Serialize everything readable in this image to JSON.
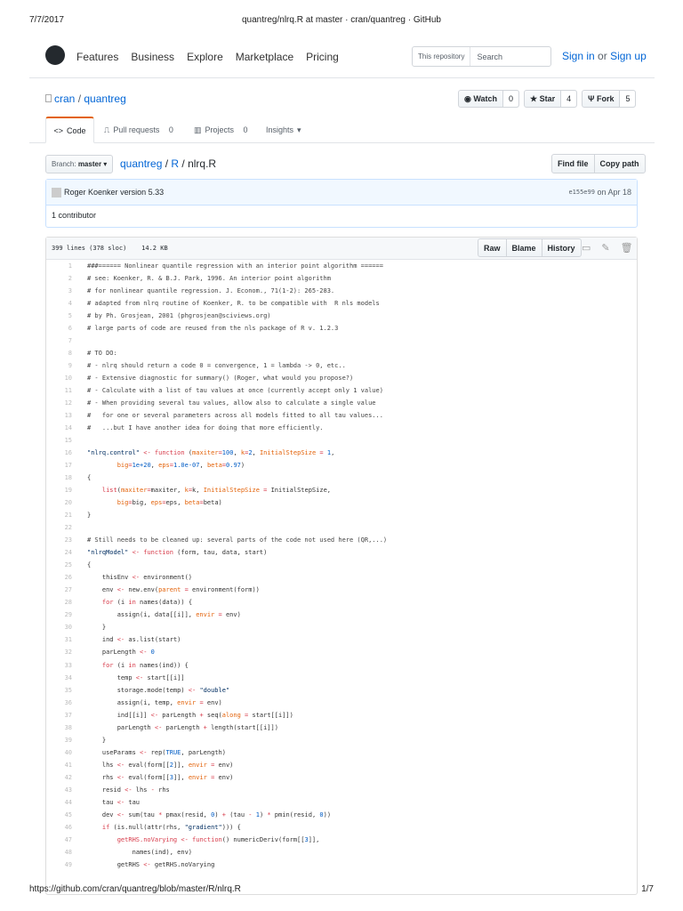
{
  "print": {
    "date": "7/7/2017",
    "title": "quantreg/nlrq.R at master · cran/quantreg · GitHub",
    "url": "https://github.com/cran/quantreg/blob/master/R/nlrq.R",
    "page": "1/7"
  },
  "nav": {
    "items": [
      "Features",
      "Business",
      "Explore",
      "Marketplace",
      "Pricing"
    ],
    "scope": "This repository",
    "search_placeholder": "Search",
    "sign_in": "Sign in",
    "or": "or",
    "sign_up": "Sign up"
  },
  "repo": {
    "owner": "cran",
    "sep": "/",
    "name": "quantreg",
    "watch": "Watch",
    "watch_count": "0",
    "star": "Star",
    "star_count": "4",
    "fork": "Fork",
    "fork_count": "5"
  },
  "tabs": [
    {
      "label": "Code",
      "count": ""
    },
    {
      "label": "Pull requests",
      "count": "0"
    },
    {
      "label": "Projects",
      "count": "0"
    },
    {
      "label": "Insights",
      "count": ""
    }
  ],
  "file": {
    "branch_label": "Branch:",
    "branch": "master",
    "crumbs": [
      "quantreg",
      "R"
    ],
    "filename": "nlrq.R",
    "find_file": "Find file",
    "copy_path": "Copy path",
    "author": "Roger Koenker",
    "message": "version 5.33",
    "sha": "e155e99",
    "date": "on Apr 18",
    "contributors": "1 contributor",
    "stats": "399 lines (378 sloc)",
    "size": "14.2 KB",
    "raw": "Raw",
    "blame": "Blame",
    "history": "History"
  },
  "code": [
    [
      [
        "###====== Nonlinear quantile regression with an interior point algorithm ======",
        "c"
      ]
    ],
    [
      [
        "# see: Koenker, R. & B.J. Park, 1996. An interior point algorithm",
        "c"
      ]
    ],
    [
      [
        "# for nonlinear quantile regression. J. Econom., 71(1-2): 265-283.",
        "c"
      ]
    ],
    [
      [
        "# adapted from nlrq routine of Koenker, R. to be compatible with  R nls models",
        "c"
      ]
    ],
    [
      [
        "# by Ph. Grosjean, 2001 (phgrosjean@sciviews.org)",
        "c"
      ]
    ],
    [
      [
        "# large parts of code are reused from the nls package of R v. 1.2.3",
        "c"
      ]
    ],
    [],
    [
      [
        "# TO DO:",
        "c"
      ]
    ],
    [
      [
        "# - nlrq should return a code 0 = convergence, 1 = lambda -> 0, etc..",
        "c"
      ]
    ],
    [
      [
        "# - Extensive diagnostic for summary() (Roger, what would you propose?)",
        "c"
      ]
    ],
    [
      [
        "# - Calculate with a list of tau values at once (currently accept only 1 value)",
        "c"
      ]
    ],
    [
      [
        "# - When providing several tau values, allow also to calculate a single value",
        "c"
      ]
    ],
    [
      [
        "#   for one or several parameters across all models fitted to all tau values...",
        "c"
      ]
    ],
    [
      [
        "#   ...but I have another idea for doing that more efficiently.",
        "c"
      ]
    ],
    [],
    [
      [
        "\"nlrq.control\"",
        "s"
      ],
      [
        " ",
        ""
      ],
      [
        "<-",
        "o"
      ],
      [
        " ",
        ""
      ],
      [
        "function",
        "k"
      ],
      [
        " (",
        ""
      ],
      [
        "maxiter",
        "p"
      ],
      [
        "=",
        "o"
      ],
      [
        "100",
        "n"
      ],
      [
        ", ",
        ""
      ],
      [
        "k",
        "p"
      ],
      [
        "=",
        "o"
      ],
      [
        "2",
        "n"
      ],
      [
        ", ",
        ""
      ],
      [
        "InitialStepSize",
        "p"
      ],
      [
        " ",
        ""
      ],
      [
        "=",
        "o"
      ],
      [
        " ",
        ""
      ],
      [
        "1",
        "n"
      ],
      [
        ",",
        ""
      ]
    ],
    [
      [
        "        ",
        ""
      ],
      [
        "big",
        "p"
      ],
      [
        "=",
        "o"
      ],
      [
        "1e+20",
        "n"
      ],
      [
        ", ",
        ""
      ],
      [
        "eps",
        "p"
      ],
      [
        "=",
        "o"
      ],
      [
        "1.0e-07",
        "n"
      ],
      [
        ", ",
        ""
      ],
      [
        "beta",
        "p"
      ],
      [
        "=",
        "o"
      ],
      [
        "0.97",
        "n"
      ],
      [
        ")",
        ""
      ]
    ],
    [
      [
        "{",
        ""
      ]
    ],
    [
      [
        "    ",
        ""
      ],
      [
        "list",
        "k"
      ],
      [
        "(",
        ""
      ],
      [
        "maxiter",
        "p"
      ],
      [
        "=",
        "o"
      ],
      [
        "maxiter, ",
        ""
      ],
      [
        "k",
        "p"
      ],
      [
        "=",
        "o"
      ],
      [
        "k, ",
        ""
      ],
      [
        "InitialStepSize",
        "p"
      ],
      [
        " ",
        ""
      ],
      [
        "=",
        "o"
      ],
      [
        " InitialStepSize,",
        ""
      ]
    ],
    [
      [
        "        ",
        ""
      ],
      [
        "big",
        "p"
      ],
      [
        "=",
        "o"
      ],
      [
        "big, ",
        ""
      ],
      [
        "eps",
        "p"
      ],
      [
        "=",
        "o"
      ],
      [
        "eps, ",
        ""
      ],
      [
        "beta",
        "p"
      ],
      [
        "=",
        "o"
      ],
      [
        "beta)",
        ""
      ]
    ],
    [
      [
        "}",
        ""
      ]
    ],
    [],
    [
      [
        "# Still needs to be cleaned up: several parts of the code not used here (QR,...)",
        "c"
      ]
    ],
    [
      [
        "\"nlrqModel\"",
        "s"
      ],
      [
        " ",
        ""
      ],
      [
        "<-",
        "o"
      ],
      [
        " ",
        ""
      ],
      [
        "function",
        "k"
      ],
      [
        " (form, tau, data, start)",
        ""
      ]
    ],
    [
      [
        "{",
        ""
      ]
    ],
    [
      [
        "    thisEnv ",
        ""
      ],
      [
        "<-",
        "o"
      ],
      [
        " environment()",
        ""
      ]
    ],
    [
      [
        "    env ",
        ""
      ],
      [
        "<-",
        "o"
      ],
      [
        " new.env(",
        ""
      ],
      [
        "parent",
        "p"
      ],
      [
        " ",
        ""
      ],
      [
        "=",
        "o"
      ],
      [
        " environment(form))",
        ""
      ]
    ],
    [
      [
        "    ",
        ""
      ],
      [
        "for",
        "k"
      ],
      [
        " (i ",
        ""
      ],
      [
        "in",
        "k"
      ],
      [
        " names(data)) {",
        ""
      ]
    ],
    [
      [
        "        assign(i, data[[i]], ",
        ""
      ],
      [
        "envir",
        "p"
      ],
      [
        " ",
        ""
      ],
      [
        "=",
        "o"
      ],
      [
        " env)",
        ""
      ]
    ],
    [
      [
        "    }",
        ""
      ]
    ],
    [
      [
        "    ind ",
        ""
      ],
      [
        "<-",
        "o"
      ],
      [
        " as.list(start)",
        ""
      ]
    ],
    [
      [
        "    parLength ",
        ""
      ],
      [
        "<-",
        "o"
      ],
      [
        " ",
        ""
      ],
      [
        "0",
        "n"
      ]
    ],
    [
      [
        "    ",
        ""
      ],
      [
        "for",
        "k"
      ],
      [
        " (i ",
        ""
      ],
      [
        "in",
        "k"
      ],
      [
        " names(ind)) {",
        ""
      ]
    ],
    [
      [
        "        temp ",
        ""
      ],
      [
        "<-",
        "o"
      ],
      [
        " start[[i]]",
        ""
      ]
    ],
    [
      [
        "        storage.mode(temp) ",
        ""
      ],
      [
        "<-",
        "o"
      ],
      [
        " ",
        ""
      ],
      [
        "\"double\"",
        "s"
      ]
    ],
    [
      [
        "        assign(i, temp, ",
        ""
      ],
      [
        "envir",
        "p"
      ],
      [
        " ",
        ""
      ],
      [
        "=",
        "o"
      ],
      [
        " env)",
        ""
      ]
    ],
    [
      [
        "        ind[[i]] ",
        ""
      ],
      [
        "<-",
        "o"
      ],
      [
        " parLength ",
        ""
      ],
      [
        "+",
        "o"
      ],
      [
        " seq(",
        ""
      ],
      [
        "along",
        "p"
      ],
      [
        " ",
        ""
      ],
      [
        "=",
        "o"
      ],
      [
        " start[[i]])",
        ""
      ]
    ],
    [
      [
        "        parLength ",
        ""
      ],
      [
        "<-",
        "o"
      ],
      [
        " parLength ",
        ""
      ],
      [
        "+",
        "o"
      ],
      [
        " length(start[[i]])",
        ""
      ]
    ],
    [
      [
        "    }",
        ""
      ]
    ],
    [
      [
        "    useParams ",
        ""
      ],
      [
        "<-",
        "o"
      ],
      [
        " rep(",
        ""
      ],
      [
        "TRUE",
        "n"
      ],
      [
        ", parLength)",
        ""
      ]
    ],
    [
      [
        "    lhs ",
        ""
      ],
      [
        "<-",
        "o"
      ],
      [
        " eval(form[[",
        ""
      ],
      [
        "2",
        "n"
      ],
      [
        "]], ",
        ""
      ],
      [
        "envir",
        "p"
      ],
      [
        " ",
        ""
      ],
      [
        "=",
        "o"
      ],
      [
        " env)",
        ""
      ]
    ],
    [
      [
        "    rhs ",
        ""
      ],
      [
        "<-",
        "o"
      ],
      [
        " eval(form[[",
        ""
      ],
      [
        "3",
        "n"
      ],
      [
        "]], ",
        ""
      ],
      [
        "envir",
        "p"
      ],
      [
        " ",
        ""
      ],
      [
        "=",
        "o"
      ],
      [
        " env)",
        ""
      ]
    ],
    [
      [
        "    resid ",
        ""
      ],
      [
        "<-",
        "o"
      ],
      [
        " lhs ",
        ""
      ],
      [
        "-",
        "o"
      ],
      [
        " rhs",
        ""
      ]
    ],
    [
      [
        "    tau ",
        ""
      ],
      [
        "<-",
        "o"
      ],
      [
        " tau",
        ""
      ]
    ],
    [
      [
        "    dev ",
        ""
      ],
      [
        "<-",
        "o"
      ],
      [
        " sum(tau ",
        ""
      ],
      [
        "*",
        "o"
      ],
      [
        " pmax(resid, ",
        ""
      ],
      [
        "0",
        "n"
      ],
      [
        ") ",
        ""
      ],
      [
        "+",
        "o"
      ],
      [
        " (tau ",
        ""
      ],
      [
        "-",
        "o"
      ],
      [
        " ",
        ""
      ],
      [
        "1",
        "n"
      ],
      [
        ") ",
        ""
      ],
      [
        "*",
        "o"
      ],
      [
        " pmin(resid, ",
        ""
      ],
      [
        "0",
        "n"
      ],
      [
        "))",
        ""
      ]
    ],
    [
      [
        "    ",
        ""
      ],
      [
        "if",
        "k"
      ],
      [
        " (is.null(attr(rhs, ",
        ""
      ],
      [
        "\"gradient\"",
        "s"
      ],
      [
        "))) {",
        ""
      ]
    ],
    [
      [
        "        ",
        ""
      ],
      [
        "getRHS.noVarying",
        "k"
      ],
      [
        " ",
        ""
      ],
      [
        "<-",
        "o"
      ],
      [
        " ",
        ""
      ],
      [
        "function",
        "k"
      ],
      [
        "() numericDeriv(form[[",
        ""
      ],
      [
        "3",
        "n"
      ],
      [
        "]],",
        ""
      ]
    ],
    [
      [
        "            names(ind), env)",
        ""
      ]
    ],
    [
      [
        "        getRHS ",
        ""
      ],
      [
        "<-",
        "o"
      ],
      [
        " getRHS.noVarying",
        ""
      ]
    ]
  ]
}
